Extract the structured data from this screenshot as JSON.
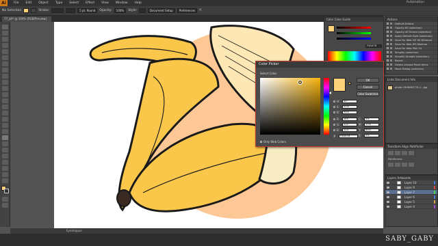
{
  "menubar": {
    "logo": "Ai",
    "items": [
      "File",
      "Edit",
      "Object",
      "Type",
      "Select",
      "Effect",
      "View",
      "Window",
      "Help"
    ],
    "workspace": "Automation"
  },
  "control_bar": {
    "selection": "No Selection",
    "stroke_label": "Stroke:",
    "brush": "5 pt. Round",
    "opacity_label": "Opacity:",
    "opacity": "100%",
    "style_label": "Style:",
    "doc_setup": "Document Setup",
    "preferences": "Preferences"
  },
  "doc_tab": "77_alt* @ 100% (RGB/Preview)",
  "status_bar": "Eyedropper",
  "color_panel": {
    "tab": "Color  Color Guide",
    "hex": "F5D47B"
  },
  "actions_panel": {
    "tab": "Actions",
    "items": [
      "Default Actions",
      "Opacity 60 (selection)",
      "Opacity 40 Screen (selection)",
      "Apply Default Style (selection)",
      "Save For Web GIF 64 Dithered",
      "Save For Web JPG Medium",
      "Save For Web PNG 24",
      "Simplify (selection)",
      "Simplify Straight (selection)",
      "Revert",
      "Delete Unused Panel Items",
      "Move Dialog (selection)"
    ]
  },
  "links_panel": {
    "tab": "Links  Document Info",
    "item": "photo-1508265774-1...jpg"
  },
  "pathfinder_panel": {
    "tab": "Transform  Align  Pathfinder",
    "sub": "Pathfinders:"
  },
  "layers_panel": {
    "tab": "Layers  Artboards",
    "rows": [
      {
        "name": "Layer 10",
        "color": "#4a7bd8"
      },
      {
        "name": "Layer 9",
        "color": "#d84a4a"
      },
      {
        "name": "Layer 7",
        "color": "#4ad84a"
      },
      {
        "name": "Layer 6",
        "color": "#4a7bd8"
      },
      {
        "name": "Layer 5",
        "color": "#d8a44a"
      },
      {
        "name": "Layer 4",
        "color": "#a44ad8"
      }
    ]
  },
  "color_picker": {
    "title": "Color Picker",
    "select_color": "Select Color:",
    "ok": "OK",
    "cancel": "Cancel",
    "swatches": "Color Swatches",
    "fields": [
      {
        "label": "H:",
        "value": "40°",
        "unit": ""
      },
      {
        "label": "S:",
        "value": "51%",
        "unit": ""
      },
      {
        "label": "B:",
        "value": "95%",
        "unit": ""
      },
      {
        "label": "R:",
        "value": "245",
        "unit": ""
      },
      {
        "label": "G:",
        "value": "212",
        "unit": ""
      },
      {
        "label": "B:",
        "value": "123",
        "unit": ""
      }
    ],
    "cmyk": [
      {
        "label": "C:",
        "value": "4%"
      },
      {
        "label": "M:",
        "value": "17%"
      },
      {
        "label": "Y:",
        "value": "60%"
      },
      {
        "label": "K:",
        "value": "0%"
      }
    ],
    "hex_label": "#",
    "hex": "F5D47B",
    "only_web": "Only Web Colors",
    "current_color": "#fbd27a"
  },
  "brand": "SABY_GABY",
  "colors": {
    "banana_yellow": "#fbc74a",
    "banana_light": "#fde8b5",
    "peel_inner": "#f7ecc4",
    "circle_peach": "#fec896",
    "outline": "#1a1a1a"
  }
}
